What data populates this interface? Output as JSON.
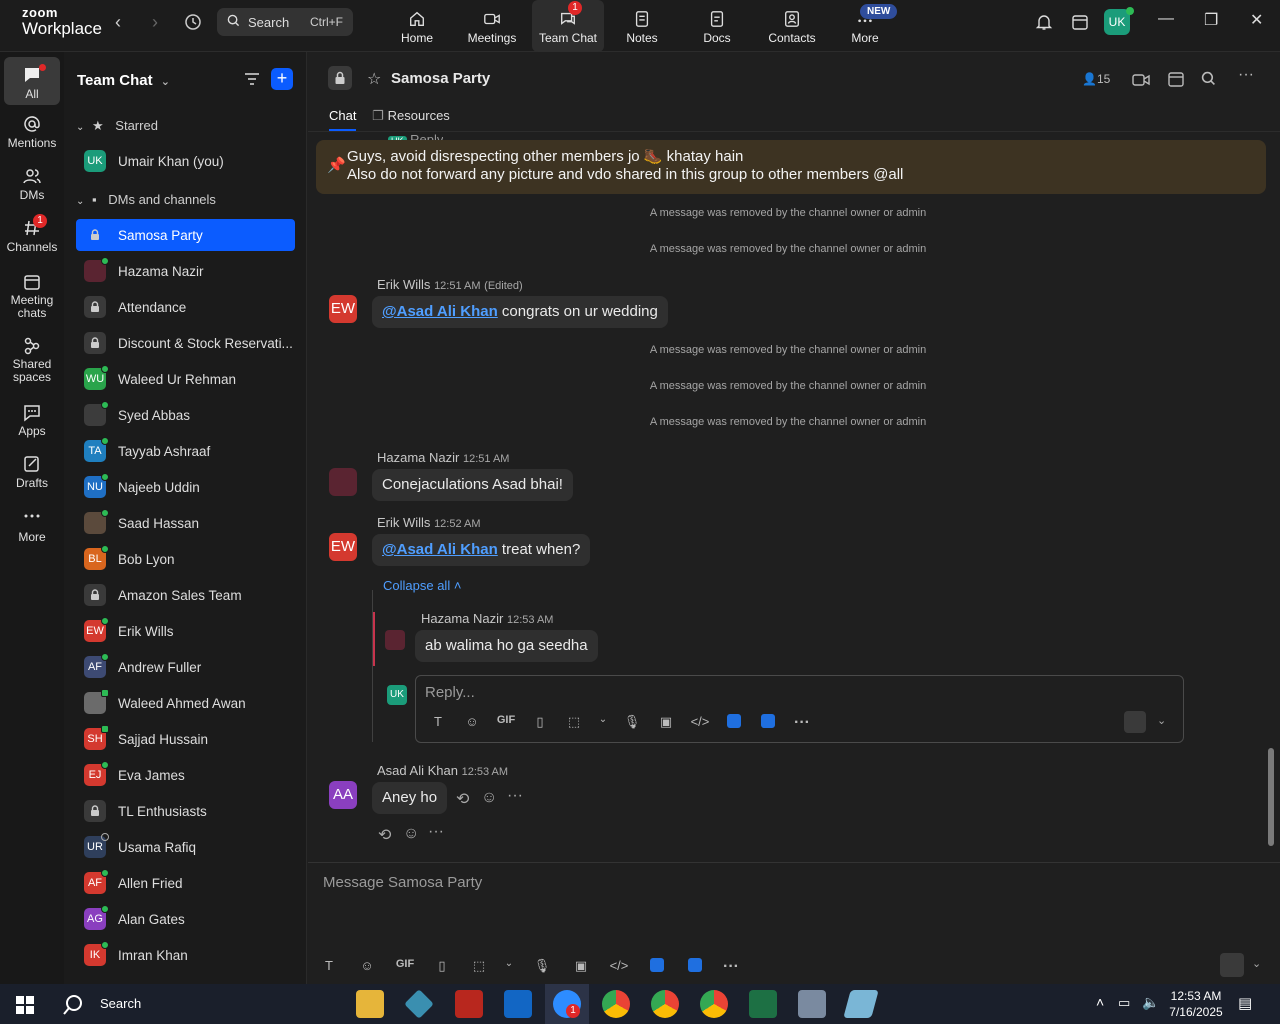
{
  "app": {
    "brand_top": "zoom",
    "brand_bottom": "Workplace",
    "search_label": "Search",
    "search_shortcut": "Ctrl+F",
    "user_initials": "UK",
    "new_badge": "NEW",
    "team_chat_badge": "1"
  },
  "nav_tabs": [
    {
      "label": "Home",
      "icon": "home-icon"
    },
    {
      "label": "Meetings",
      "icon": "video-icon"
    },
    {
      "label": "Team Chat",
      "icon": "chat-icon"
    },
    {
      "label": "Notes",
      "icon": "notes-icon"
    },
    {
      "label": "Docs",
      "icon": "docs-icon"
    },
    {
      "label": "Contacts",
      "icon": "contacts-icon"
    },
    {
      "label": "More",
      "icon": "more-icon"
    }
  ],
  "rail": [
    {
      "label": "All",
      "icon": "chat-bubble-icon"
    },
    {
      "label": "Mentions",
      "icon": "at-icon"
    },
    {
      "label": "DMs",
      "icon": "people-icon"
    },
    {
      "label": "Channels",
      "icon": "hash-icon",
      "badge": "1"
    },
    {
      "label": "Meeting chats",
      "icon": "calendar-icon"
    },
    {
      "label": "Shared spaces",
      "icon": "share-icon"
    },
    {
      "label": "Apps",
      "icon": "apps-icon"
    },
    {
      "label": "Drafts",
      "icon": "drafts-icon"
    },
    {
      "label": "More",
      "icon": "ellipsis-icon"
    }
  ],
  "sidebar": {
    "title": "Team Chat",
    "starred_label": "Starred",
    "dms_label": "DMs and channels",
    "starred_items": [
      {
        "name": "Umair Khan (you)",
        "initials": "UK",
        "color": "#1b9c7a",
        "presence": "online"
      }
    ],
    "items": [
      {
        "name": "Samosa Party",
        "type": "channel",
        "selected": true
      },
      {
        "name": "Hazama Nazir",
        "initials": "",
        "color": "#5a2431",
        "presence": "online"
      },
      {
        "name": "Attendance",
        "type": "channel"
      },
      {
        "name": "Discount & Stock Reservati...",
        "type": "channel"
      },
      {
        "name": "Waleed Ur Rehman",
        "initials": "WU",
        "color": "#2aa44b",
        "presence": "online"
      },
      {
        "name": "Syed Abbas",
        "initials": "",
        "color": "#3c3c3c",
        "presence": "online"
      },
      {
        "name": "Tayyab Ashraaf",
        "initials": "TA",
        "color": "#1f7fbf",
        "presence": "online"
      },
      {
        "name": "Najeeb Uddin",
        "initials": "NU",
        "color": "#1f6fc4",
        "presence": "online"
      },
      {
        "name": "Saad Hassan",
        "initials": "",
        "color": "#5b4a3c",
        "presence": "online"
      },
      {
        "name": "Bob Lyon",
        "initials": "BL",
        "color": "#d9661e",
        "presence": "online"
      },
      {
        "name": "Amazon Sales Team",
        "type": "channel"
      },
      {
        "name": "Erik Wills",
        "initials": "EW",
        "color": "#d4392f",
        "presence": "online"
      },
      {
        "name": "Andrew Fuller",
        "initials": "AF",
        "color": "#3d4a73",
        "presence": "online"
      },
      {
        "name": "Waleed Ahmed Awan",
        "initials": "",
        "color": "#6b6b6b",
        "presence": "mobile"
      },
      {
        "name": "Sajjad Hussain",
        "initials": "SH",
        "color": "#d4392f",
        "presence": "mobile"
      },
      {
        "name": "Eva James",
        "initials": "EJ",
        "color": "#d4392f",
        "presence": "online"
      },
      {
        "name": "TL Enthusiasts",
        "type": "channel"
      },
      {
        "name": "Usama Rafiq",
        "initials": "UR",
        "color": "#2f3f5c",
        "presence": "offline"
      },
      {
        "name": "Allen Fried",
        "initials": "AF",
        "color": "#d4392f",
        "presence": "online"
      },
      {
        "name": "Alan Gates",
        "initials": "AG",
        "color": "#8a3fbf",
        "presence": "online"
      },
      {
        "name": "Imran Khan",
        "initials": "IK",
        "color": "#d4392f",
        "presence": "online"
      }
    ]
  },
  "channel": {
    "name": "Samosa Party",
    "member_count": "15",
    "tabs": [
      "Chat",
      "Resources"
    ],
    "partial_top": "Reply",
    "pinned_line1": "Guys, avoid disrespecting other members jo 🥾 khatay hain",
    "pinned_line2": "Also do not forward any picture and vdo shared in this group to other members @all",
    "removed_text": "A message was removed by the channel owner or admin"
  },
  "messages": [
    {
      "sender": "Erik Wills",
      "initials": "EW",
      "color": "#d4392f",
      "time": "12:51 AM",
      "edited": "(Edited)",
      "mention": "@Asad Ali Khan",
      "text": " congrats on ur wedding"
    },
    {
      "sender": "Hazama Nazir",
      "initials": "",
      "color": "#5a2431",
      "time": "12:51 AM",
      "text": "Conejaculations Asad bhai!"
    },
    {
      "sender": "Erik Wills",
      "initials": "EW",
      "color": "#d4392f",
      "time": "12:52 AM",
      "mention": "@Asad Ali Khan",
      "text": " treat when?"
    },
    {
      "sender": "Asad Ali Khan",
      "initials": "AA",
      "color": "#8a3fbf",
      "time": "12:53 AM",
      "text": "Aney ho"
    }
  ],
  "thread": {
    "collapse_label": "Collapse all",
    "reply": {
      "sender": "Hazama Nazir",
      "time": "12:53 AM",
      "text": "ab walima ho ga seedha"
    },
    "reply_placeholder": "Reply...",
    "reply_avatar": "UK"
  },
  "composer": {
    "placeholder": "Message Samosa Party"
  },
  "toolbar_labels": {
    "gif": "GIF"
  },
  "taskbar": {
    "search": "Search",
    "time": "12:53 AM",
    "date": "7/16/2025",
    "zoom_badge": "1"
  }
}
